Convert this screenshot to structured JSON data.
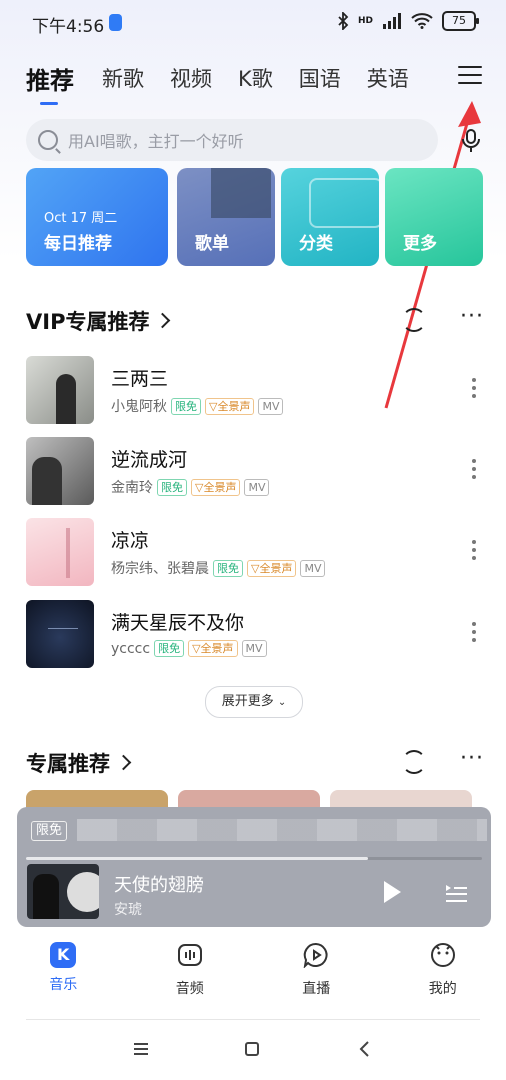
{
  "status_bar": {
    "time": "下午4:56",
    "battery": "75",
    "network": "HD"
  },
  "tabs": [
    {
      "label": "推荐",
      "active": true
    },
    {
      "label": "新歌"
    },
    {
      "label": "视频"
    },
    {
      "label": "K歌"
    },
    {
      "label": "国语"
    },
    {
      "label": "英语"
    }
  ],
  "search": {
    "placeholder": "用AI唱歌，主打一个好听"
  },
  "cards": {
    "daily": {
      "date": "Oct 17 周二",
      "label": "每日推荐"
    },
    "playlist": {
      "label": "歌单"
    },
    "category": {
      "label": "分类"
    },
    "more": {
      "label": "更多"
    }
  },
  "vip_section": {
    "title": "VIP专属推荐"
  },
  "songs": [
    {
      "title": "三两三",
      "artist": "小鬼阿秋",
      "tags": [
        "限免",
        "全景声",
        "MV"
      ]
    },
    {
      "title": "逆流成河",
      "artist": "金南玲",
      "tags": [
        "限免",
        "全景声",
        "MV"
      ]
    },
    {
      "title": "凉凉",
      "artist": "杨宗纬、张碧晨",
      "tags": [
        "限免",
        "全景声",
        "MV"
      ]
    },
    {
      "title": "满天星辰不及你",
      "artist": "ycccc",
      "tags": [
        "限免",
        "全景声",
        "MV"
      ]
    }
  ],
  "expand_more": "展开更多",
  "exclusive_section": {
    "title": "专属推荐"
  },
  "player": {
    "tag": "限免",
    "title": "天使的翅膀",
    "artist": "安琥",
    "progress": 0.75
  },
  "bottom_nav": [
    {
      "label": "音乐",
      "icon": "music-k-icon",
      "active": true
    },
    {
      "label": "音频",
      "icon": "audio-icon"
    },
    {
      "label": "直播",
      "icon": "live-icon"
    },
    {
      "label": "我的",
      "icon": "profile-icon"
    }
  ],
  "colors": {
    "accent": "#2f6df5",
    "free_tag": "#26b37c",
    "audio_tag": "#d9892a"
  }
}
